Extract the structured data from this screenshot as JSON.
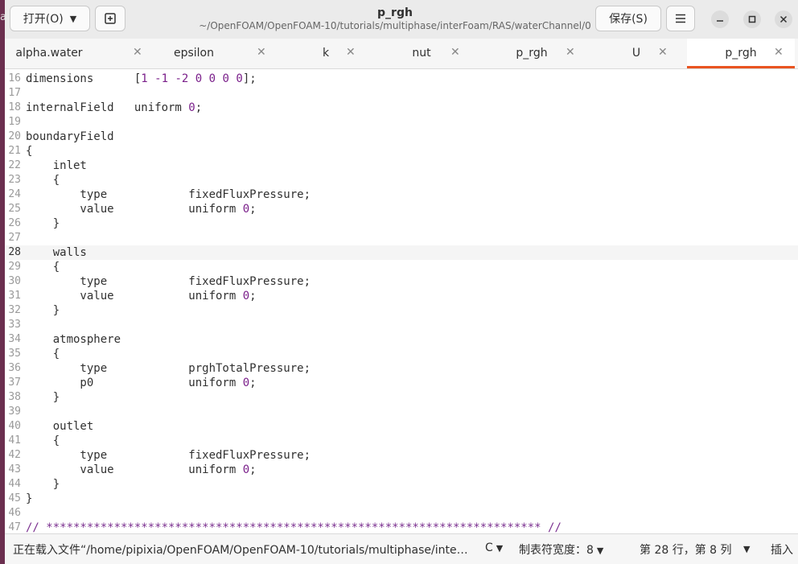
{
  "header": {
    "open_label": "打开(O)",
    "title": "p_rgh",
    "path": "~/OpenFOAM/OpenFOAM-10/tutorials/multiphase/interFoam/RAS/waterChannel/0",
    "save_label": "保存(S)"
  },
  "tabs": [
    {
      "label": "alpha.water",
      "active": false
    },
    {
      "label": "epsilon",
      "active": false
    },
    {
      "label": "k",
      "active": false
    },
    {
      "label": "nut",
      "active": false
    },
    {
      "label": "p_rgh",
      "active": false
    },
    {
      "label": "U",
      "active": false
    },
    {
      "label": "p_rgh",
      "active": true
    }
  ],
  "editor": {
    "current_line": 28,
    "lines": [
      {
        "n": "16",
        "text": "dimensions      [1 -1 -2 0 0 0 0];"
      },
      {
        "n": "17",
        "text": ""
      },
      {
        "n": "18",
        "text": "internalField   uniform 0;"
      },
      {
        "n": "19",
        "text": ""
      },
      {
        "n": "20",
        "text": "boundaryField"
      },
      {
        "n": "21",
        "text": "{"
      },
      {
        "n": "22",
        "text": "    inlet"
      },
      {
        "n": "23",
        "text": "    {"
      },
      {
        "n": "24",
        "text": "        type            fixedFluxPressure;"
      },
      {
        "n": "25",
        "text": "        value           uniform 0;"
      },
      {
        "n": "26",
        "text": "    }"
      },
      {
        "n": "27",
        "text": ""
      },
      {
        "n": "28",
        "text": "    walls"
      },
      {
        "n": "29",
        "text": "    {"
      },
      {
        "n": "30",
        "text": "        type            fixedFluxPressure;"
      },
      {
        "n": "31",
        "text": "        value           uniform 0;"
      },
      {
        "n": "32",
        "text": "    }"
      },
      {
        "n": "33",
        "text": ""
      },
      {
        "n": "34",
        "text": "    atmosphere"
      },
      {
        "n": "35",
        "text": "    {"
      },
      {
        "n": "36",
        "text": "        type            prghTotalPressure;"
      },
      {
        "n": "37",
        "text": "        p0              uniform 0;"
      },
      {
        "n": "38",
        "text": "    }"
      },
      {
        "n": "39",
        "text": ""
      },
      {
        "n": "40",
        "text": "    outlet"
      },
      {
        "n": "41",
        "text": "    {"
      },
      {
        "n": "42",
        "text": "        type            fixedFluxPressure;"
      },
      {
        "n": "43",
        "text": "        value           uniform 0;"
      },
      {
        "n": "44",
        "text": "    }"
      },
      {
        "n": "45",
        "text": "}"
      },
      {
        "n": "46",
        "text": ""
      },
      {
        "n": "47",
        "text": "// ************************************************************************* //"
      }
    ]
  },
  "status": {
    "message": "正在载入文件“/home/pipixia/OpenFOAM/OpenFOAM-10/tutorials/multiphase/inte…",
    "language": "C",
    "tab_width": "制表符宽度：8",
    "position": "第 28 行，第 8 列",
    "mode": "插入"
  },
  "colors": {
    "accent": "#e95420",
    "number": "#7a1f8a",
    "comment": "#7a2f8f",
    "background_desktop": "#5a2a44"
  }
}
